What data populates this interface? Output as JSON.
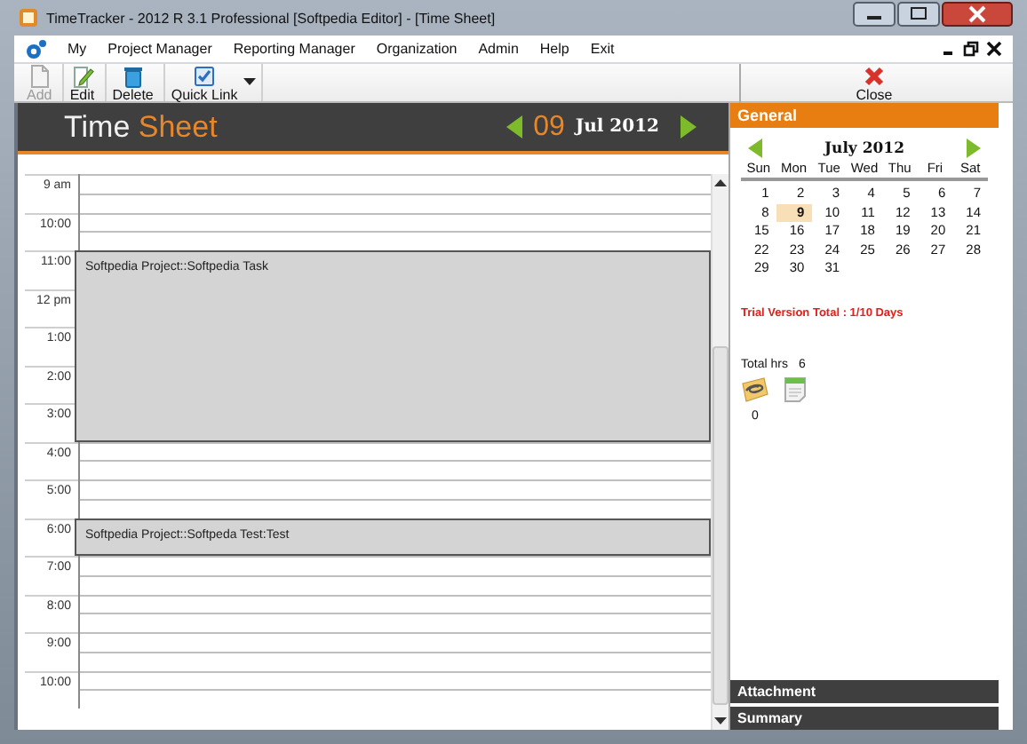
{
  "window": {
    "title": "TimeTracker - 2012 R 3.1 Professional [Softpedia Editor] - [Time Sheet]"
  },
  "menu": [
    {
      "label": "My"
    },
    {
      "label": "Project Manager"
    },
    {
      "label": "Reporting Manager"
    },
    {
      "label": "Organization"
    },
    {
      "label": "Admin"
    },
    {
      "label": "Help"
    },
    {
      "label": "Exit"
    }
  ],
  "toolbar": [
    {
      "kind": "add",
      "label": "Add",
      "disabled": true
    },
    {
      "kind": "edit",
      "label": "Edit",
      "disabled": false
    },
    {
      "kind": "delete",
      "label": "Delete",
      "disabled": false
    },
    {
      "kind": "link",
      "label": "Quick Link",
      "disabled": false,
      "dropdown": true
    },
    {
      "kind": "close",
      "label": "Close",
      "disabled": false
    }
  ],
  "sheet": {
    "title": "Time",
    "title_accent": "Sheet",
    "day": "09",
    "month_year": "Jul 2012"
  },
  "timeline": [
    {
      "kind": "hour",
      "label": "9 am"
    },
    {
      "kind": "hour",
      "label": "10:00"
    },
    {
      "kind": "event",
      "text": "Softpedia Project::Softpedia Task",
      "hours": [
        "11:00",
        "12 pm",
        "1:00",
        "2:00",
        "3:00"
      ]
    },
    {
      "kind": "hour",
      "label": "4:00"
    },
    {
      "kind": "hour",
      "label": "5:00"
    },
    {
      "kind": "event",
      "text": "Softpedia Project::Softpeda Test:Test",
      "hours": [
        "6:00"
      ]
    },
    {
      "kind": "hour",
      "label": "7:00"
    },
    {
      "kind": "hour",
      "label": "8:00"
    },
    {
      "kind": "hour",
      "label": "9:00"
    },
    {
      "kind": "hour",
      "label": "10:00"
    }
  ],
  "general": {
    "title": "General",
    "calendar": {
      "month": "July 2012",
      "weekdays": [
        "Sun",
        "Mon",
        "Tue",
        "Wed",
        "Thu",
        "Fri",
        "Sat"
      ],
      "weeks": [
        [
          {
            "day": "1",
            "selected": false
          },
          {
            "day": "2",
            "selected": false
          },
          {
            "day": "3",
            "selected": false
          },
          {
            "day": "4",
            "selected": false
          },
          {
            "day": "5",
            "selected": false
          },
          {
            "day": "6",
            "selected": false
          },
          {
            "day": "7",
            "selected": false
          }
        ],
        [
          {
            "day": "8",
            "selected": false
          },
          {
            "day": "9",
            "selected": true
          },
          {
            "day": "10",
            "selected": false
          },
          {
            "day": "11",
            "selected": false
          },
          {
            "day": "12",
            "selected": false
          },
          {
            "day": "13",
            "selected": false
          },
          {
            "day": "14",
            "selected": false
          }
        ],
        [
          {
            "day": "15",
            "selected": false
          },
          {
            "day": "16",
            "selected": false
          },
          {
            "day": "17",
            "selected": false
          },
          {
            "day": "18",
            "selected": false
          },
          {
            "day": "19",
            "selected": false
          },
          {
            "day": "20",
            "selected": false
          },
          {
            "day": "21",
            "selected": false
          }
        ],
        [
          {
            "day": "22",
            "selected": false
          },
          {
            "day": "23",
            "selected": false
          },
          {
            "day": "24",
            "selected": false
          },
          {
            "day": "25",
            "selected": false
          },
          {
            "day": "26",
            "selected": false
          },
          {
            "day": "27",
            "selected": false
          },
          {
            "day": "28",
            "selected": false
          }
        ],
        [
          {
            "day": "29",
            "selected": false
          },
          {
            "day": "30",
            "selected": false
          },
          {
            "day": "31",
            "selected": false
          }
        ]
      ]
    },
    "trial": "Trial Version Total : 1/10 Days",
    "total_label": "Total hrs",
    "total_value": "6",
    "attachment_count": "0"
  },
  "sections": [
    {
      "title": "Attachment"
    },
    {
      "title": "Summary"
    }
  ]
}
